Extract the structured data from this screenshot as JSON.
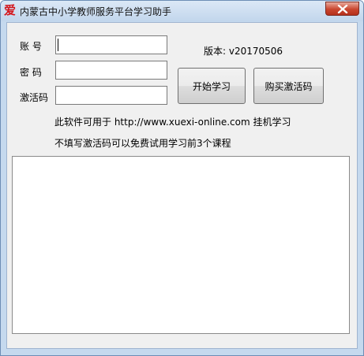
{
  "window": {
    "title": "内蒙古中小学教师服务平台学习助手",
    "icon_glyph": "爱",
    "close_glyph": "x"
  },
  "form": {
    "account_label": "账  号",
    "account_value": "",
    "password_label": "密  码",
    "password_value": "",
    "activation_label": "激活码",
    "activation_value": ""
  },
  "version": {
    "text": "版本: v20170506"
  },
  "buttons": {
    "start_label": "开始学习",
    "buy_label": "购买激活码"
  },
  "info": {
    "line1": "此软件可用于 http://www.xuexi-online.com 挂机学习",
    "line2": "不填写激活码可以免费试用学习前3个课程"
  },
  "log": {
    "content": ""
  },
  "colors": {
    "frame": "#c5d9ee",
    "client_bg": "#f0f0f0",
    "close_red": "#c9462f",
    "icon_red": "#d4151b"
  }
}
